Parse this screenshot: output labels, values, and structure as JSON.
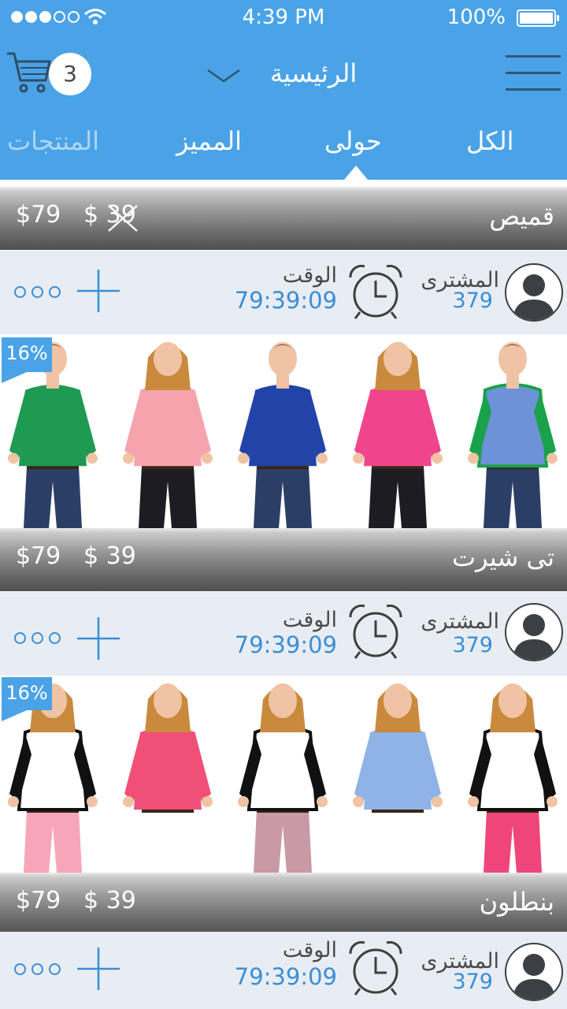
{
  "status_bar": {
    "time": "4:39 PM",
    "battery": "100%",
    "signal_filled": 3,
    "signal_total": 5
  },
  "header": {
    "cart_count": "3",
    "title": "الرئيسية",
    "tabs": [
      {
        "label": "الكل"
      },
      {
        "label": "حولى"
      },
      {
        "label": "المميز"
      },
      {
        "label": "المنتجات"
      }
    ],
    "active_tab": "حولى"
  },
  "products": [
    {
      "name": "قميص",
      "price": "$79",
      "old_price": "$ 39",
      "old_price_struck": true,
      "buyer_label": "المشترى",
      "buyer_count": "379",
      "time_label": "الوقت",
      "time_value": "79:39:09",
      "discount": "16%",
      "models": [
        {
          "top": "#1f9a52",
          "accent": "#1f9a52",
          "bottom": "#2b3f66",
          "gender": "m"
        },
        {
          "top": "#f5a4ad",
          "accent": "#f5a4ad",
          "bottom": "#1c1c22",
          "gender": "f"
        },
        {
          "top": "#2243a8",
          "accent": "#2243a8",
          "bottom": "#2b3f66",
          "gender": "m"
        },
        {
          "top": "#f0458d",
          "accent": "#f0458d",
          "bottom": "#1c1c22",
          "gender": "f"
        },
        {
          "top": "#6e92d8",
          "accent": "#1aa24a",
          "bottom": "#2b3f66",
          "gender": "m"
        }
      ]
    },
    {
      "name": "تى شيرت",
      "price": "$79",
      "old_price": "$ 39",
      "old_price_struck": false,
      "buyer_label": "المشترى",
      "buyer_count": "379",
      "time_label": "الوقت",
      "time_value": "79:39:09",
      "discount": "16%",
      "models": [
        {
          "top": "#ffffff",
          "accent": "#111111",
          "bottom": "#f7a6b9",
          "gender": "f"
        },
        {
          "top": "#f04f78",
          "accent": "#f04f78",
          "bottom": "#ffffff",
          "gender": "f"
        },
        {
          "top": "#ffffff",
          "accent": "#111111",
          "bottom": "#c79aa5",
          "gender": "f"
        },
        {
          "top": "#8fb3e6",
          "accent": "#8fb3e6",
          "bottom": "#ffffff",
          "gender": "f"
        },
        {
          "top": "#ffffff",
          "accent": "#111111",
          "bottom": "#f0457a",
          "gender": "f"
        }
      ]
    },
    {
      "name": "بنطلون",
      "price": "$79",
      "old_price": "$ 39",
      "old_price_struck": false,
      "buyer_label": "المشترى",
      "buyer_count": "379",
      "time_label": "الوقت",
      "time_value": "79:39:09"
    }
  ]
}
